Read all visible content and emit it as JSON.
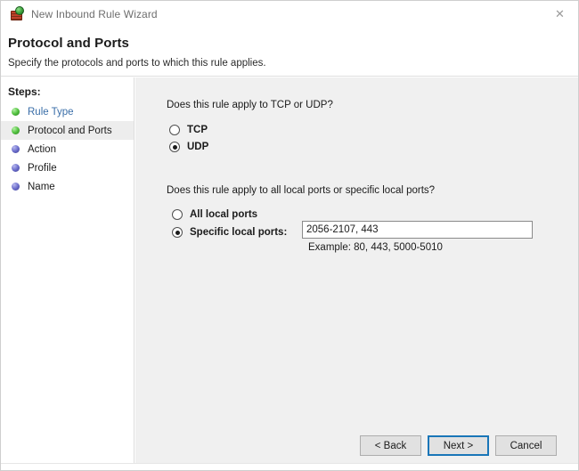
{
  "window": {
    "title": "New Inbound Rule Wizard",
    "icon": "firewall-brick-globe-icon",
    "close_label": "✕"
  },
  "header": {
    "title": "Protocol and Ports",
    "subtitle": "Specify the protocols and ports to which this rule applies."
  },
  "sidebar": {
    "heading": "Steps:",
    "items": [
      {
        "label": "Rule Type",
        "bullet": "green",
        "state": "completed-link"
      },
      {
        "label": "Protocol and Ports",
        "bullet": "green",
        "state": "current"
      },
      {
        "label": "Action",
        "bullet": "blue",
        "state": "pending"
      },
      {
        "label": "Profile",
        "bullet": "blue",
        "state": "pending"
      },
      {
        "label": "Name",
        "bullet": "blue",
        "state": "pending"
      }
    ]
  },
  "main": {
    "protocol_question": "Does this rule apply to TCP or UDP?",
    "protocol_options": [
      {
        "label": "TCP",
        "selected": false
      },
      {
        "label": "UDP",
        "selected": true
      }
    ],
    "ports_question": "Does this rule apply to all local ports or specific local ports?",
    "ports_options": [
      {
        "label": "All local ports",
        "selected": false
      },
      {
        "label": "Specific local ports:",
        "selected": true
      }
    ],
    "ports_value": "2056-2107, 443",
    "ports_placeholder": "",
    "example_text": "Example: 80, 443, 5000-5010"
  },
  "footer": {
    "back_label": "< Back",
    "next_label": "Next >",
    "cancel_label": "Cancel"
  },
  "colors": {
    "accent": "#1976b8",
    "link": "#3a6ea8",
    "panel_bg": "#f0f0f0",
    "sidebar_bg": "#ffffff",
    "current_step_bg": "#ededed"
  }
}
